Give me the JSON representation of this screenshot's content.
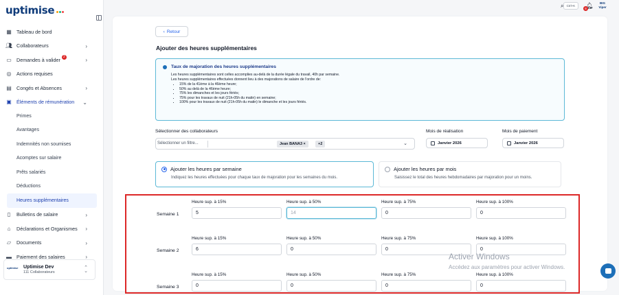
{
  "app": {
    "logo_text": "uptimise",
    "brand_colors": [
      "#0f3b7a",
      "#f59e0b",
      "#10b981",
      "#ef4444"
    ]
  },
  "sidebar": {
    "items": [
      {
        "label": "Tableau de bord",
        "icon": "grid-icon"
      },
      {
        "label": "Collaborateurs",
        "icon": "users-icon",
        "chevron": "›"
      },
      {
        "label": "Demandes à valider",
        "icon": "inbox-icon",
        "badge": "2",
        "chevron": "›"
      },
      {
        "label": "Actions requises",
        "icon": "check-circle-icon"
      },
      {
        "label": "Congés et Absences",
        "icon": "calendar-icon",
        "chevron": "›"
      },
      {
        "label": "Éléments de rémunération",
        "icon": "wallet-icon",
        "chevron": "⌄"
      }
    ],
    "subitems": [
      "Primes",
      "Avantages",
      "Indemnités non soumises",
      "Acomptes sur salaire",
      "Prêts salariés",
      "Déductions",
      "Heures supplémentaires"
    ],
    "items_bottom": [
      {
        "label": "Bulletins de salaire",
        "icon": "file-icon",
        "chevron": "›"
      },
      {
        "label": "Déclarations et Organismes",
        "icon": "bank-icon",
        "chevron": "›"
      },
      {
        "label": "Documents",
        "icon": "folder-icon",
        "chevron": "›"
      },
      {
        "label": "Paiement des salaires",
        "icon": "payment-icon",
        "chevron": "›"
      }
    ],
    "user": {
      "name": "Uptimise Dev",
      "sub": "111 Collaborateurs",
      "logo": "uptimise"
    }
  },
  "header": {
    "ctrl_k": "Ctrl+K",
    "notif_count": "8",
    "avatar_text": "BIG Viper"
  },
  "page": {
    "back_label": "Retour",
    "title": "Ajouter des heures supplémentaires",
    "info": {
      "title": "Taux de majoration des heures supplémentaires",
      "p1": "Les heures supplémentaires sont celles accomplies au-delà de la durée légale du travail, 40h par semaine.",
      "p2": "Les heures supplémentaires effectuées donnent lieu à des majorations de salaire de l'ordre de:",
      "list": [
        "15% de la 41ème à la 46ème heure;",
        "50% au delà de la 46ème heure;",
        "75% les dimanches et les jours fériés;",
        "75% pour les travaux de nuit (21h-05h du matin) en semaine;",
        "100% pour les travaux de nuit (21h-05h du matin) le dimanche et les jours fériés."
      ]
    },
    "collab_label": "Sélectionner des collaborateurs",
    "filter_placeholder": "Sélectionner un filtre...",
    "tag1": "Jean BANA3",
    "tag1_remove": "×",
    "tag_more": "+2",
    "mois_realisation_label": "Mois de réalisation",
    "mois_realisation": "Janvier 2026",
    "mois_paiement_label": "Mois de paiement",
    "mois_paiement": "Janvier 2026",
    "option_week": {
      "title": "Ajouter les heures par semaine",
      "desc": "Indiquez les heures effectuées pour chaque taux de majoration pour les semaines du mois."
    },
    "option_month": {
      "title": "Ajouter les heures par mois",
      "desc": "Saisissez le total des heures hebdomadaires par majoration pour un moins."
    },
    "rate_labels": [
      "Heure sup. à 15%",
      "Heure sup. à 50%",
      "Heure sup. à 75%",
      "Heure sup. à 100%"
    ],
    "weeks": [
      {
        "label": "Semaine 1",
        "values": [
          "5",
          "",
          "0",
          "0"
        ],
        "placeholder_50": "14"
      },
      {
        "label": "Semaine 2",
        "values": [
          "6",
          "0",
          "0",
          "0"
        ]
      },
      {
        "label": "Semaine 3",
        "values": [
          "0",
          "0",
          "0",
          "0"
        ]
      }
    ]
  },
  "watermark": {
    "line1": "Activer Windows",
    "line2": "Accédez aux paramètres pour activer Windows."
  }
}
